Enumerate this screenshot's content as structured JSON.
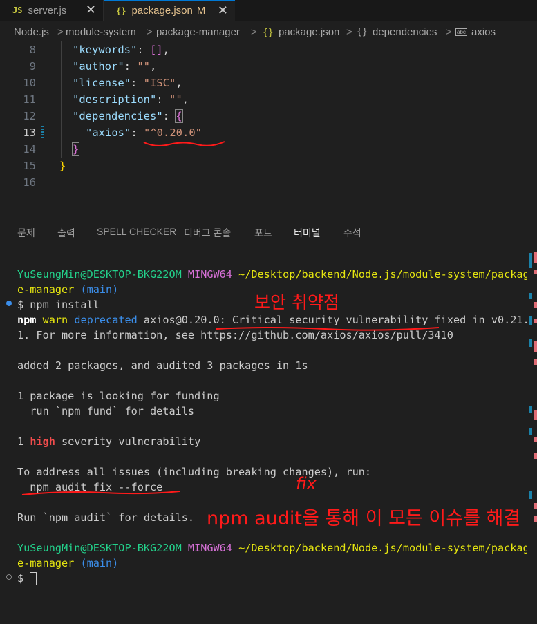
{
  "tabs": [
    {
      "icon": "JS",
      "label": "server.js",
      "close": "✕"
    },
    {
      "icon": "{}",
      "label": "package.json",
      "modified": "M",
      "close": "✕"
    }
  ],
  "breadcrumb": {
    "items": [
      "Node.js",
      "module-system",
      "package-manager",
      "package.json",
      "dependencies",
      "axios"
    ],
    "separator": ">",
    "json_icon": "{}",
    "string_icon": "abc"
  },
  "editor": {
    "line_numbers": [
      "8",
      "9",
      "10",
      "11",
      "12",
      "13",
      "14",
      "15",
      "16"
    ],
    "lines": {
      "l8_key": "\"keywords\"",
      "l8_colon": ": ",
      "l8_val": "[]",
      "l8_end": ",",
      "l9_key": "\"author\"",
      "l9_colon": ": ",
      "l9_val": "\"\"",
      "l9_end": ",",
      "l10_key": "\"license\"",
      "l10_colon": ": ",
      "l10_val": "\"ISC\"",
      "l10_end": ",",
      "l11_key": "\"description\"",
      "l11_colon": ": ",
      "l11_val": "\"\"",
      "l11_end": ",",
      "l12_key": "\"dependencies\"",
      "l12_colon": ": ",
      "l12_val": "{",
      "l13_key": "\"axios\"",
      "l13_colon": ": ",
      "l13_val": "\"^0.20.0\"",
      "l14": "}",
      "l15": "}"
    }
  },
  "panel_tabs": [
    "문제",
    "출력",
    "SPELL CHECKER",
    "디버그 콘솔",
    "포트",
    "터미널",
    "주석"
  ],
  "active_panel_tab": "터미널",
  "terminal": {
    "prompt1": {
      "user": "YuSeungMin@DESKTOP-BKG22OM",
      "shell": "MINGW64",
      "path1": "~/Desktop/backend/Node.js/module-system/packag",
      "path2": "e-manager",
      "branch": "(main)"
    },
    "cmd": "$ npm install",
    "warn": {
      "npm": "npm",
      "warn": "warn",
      "deprecated": "deprecated",
      "msg": "axios@0.20.0: Critical security vulnerability fixed in v0.21.",
      "msg2": "1. For more information, see https://github.com/axios/axios/pull/3410"
    },
    "added": "added 2 packages, and audited 3 packages in 1s",
    "funding1": "1 package is looking for funding",
    "funding2": "  run `npm fund` for details",
    "vuln": {
      "count": "1",
      "level": "high",
      "rest": "severity vulnerability"
    },
    "address": "To address all issues (including breaking changes), run:",
    "fix_cmd": "  npm audit fix --force",
    "run_audit": "Run `npm audit` for details.",
    "prompt2": {
      "user": "YuSeungMin@DESKTOP-BKG22OM",
      "shell": "MINGW64",
      "path1": "~/Desktop/backend/Node.js/module-system/packag",
      "path2": "e-manager",
      "branch": "(main)"
    },
    "prompt_end": "$ "
  },
  "annotations": {
    "security": "보안 취약점",
    "fix": "fix",
    "resolve": "npm audit을 통해 이 모든 이슈를 해결"
  },
  "colors": {
    "accent": "#0078d4",
    "annotation": "#ff1a1a",
    "terminal_green": "#23d18b",
    "terminal_magenta": "#d670d6"
  }
}
